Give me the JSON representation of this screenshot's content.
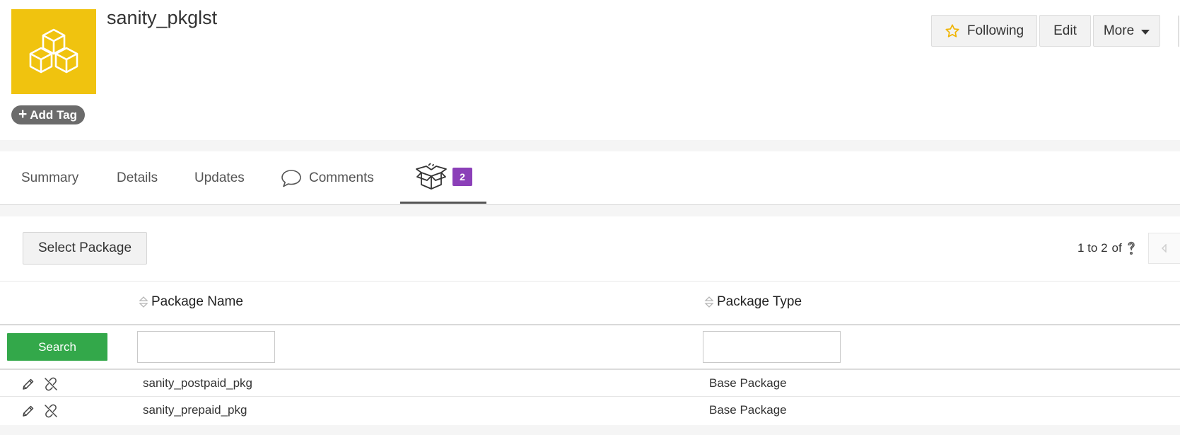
{
  "header": {
    "title": "sanity_pkglst",
    "add_tag_label": "Add Tag",
    "logo_icon": "cubes-icon",
    "logo_color": "#f0c30f",
    "buttons": {
      "following": "Following",
      "edit": "Edit",
      "more": "More"
    }
  },
  "tabs": [
    {
      "label": "Summary"
    },
    {
      "label": "Details"
    },
    {
      "label": "Updates"
    },
    {
      "label": "Comments",
      "icon": "speech-bubble-icon"
    },
    {
      "label": "",
      "icon": "open-box-icon",
      "badge": "2",
      "active": true
    }
  ],
  "toolbar": {
    "select_package_label": "Select Package",
    "pager": {
      "range": "1 to 2",
      "of_label": "of"
    }
  },
  "table": {
    "columns": [
      "Package Name",
      "Package Type"
    ],
    "search_label": "Search",
    "filters": {
      "name": "",
      "type": ""
    },
    "rows": [
      {
        "name": "sanity_postpaid_pkg",
        "type": "Base Package"
      },
      {
        "name": "sanity_prepaid_pkg",
        "type": "Base Package"
      }
    ]
  },
  "colors": {
    "search_button": "#33a84a",
    "badge": "#8b3fb8",
    "star": "#f0b400"
  }
}
